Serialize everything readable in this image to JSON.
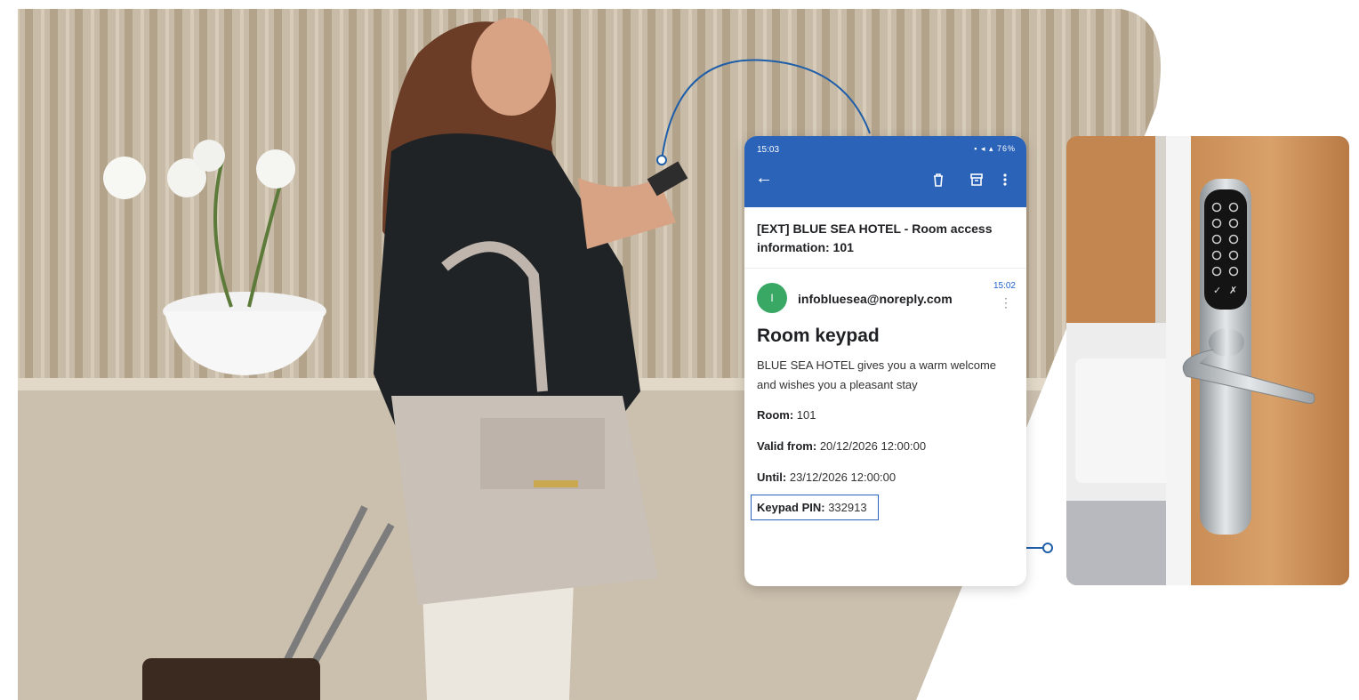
{
  "colors": {
    "accent": "#2a63b8",
    "avatar": "#3aa865",
    "connector": "#1f5ea8"
  },
  "status_bar": {
    "time": "15:03",
    "battery": "76%"
  },
  "toolbar": {
    "back_icon": "arrow-left-icon",
    "delete_icon": "trash-icon",
    "archive_icon": "archive-icon",
    "more_icon": "more-vertical-icon"
  },
  "email": {
    "subject": "[EXT] BLUE SEA HOTEL - Room access information: 101",
    "avatar_letter": "I",
    "sender": "infobluesea@noreply.com",
    "time": "15:02",
    "heading": "Room keypad",
    "message": "BLUE SEA HOTEL gives you a warm welcome and wishes you a pleasant stay",
    "room_label": "Room:",
    "room_value": "101",
    "valid_from_label": "Valid from:",
    "valid_from_value": "20/12/2026 12:00:00",
    "until_label": "Until:",
    "until_value": "23/12/2026 12:00:00",
    "pin_label": "Keypad PIN:",
    "pin_value": "332913"
  },
  "keypad": {
    "confirm_symbol": "✓",
    "cancel_symbol": "✗"
  }
}
